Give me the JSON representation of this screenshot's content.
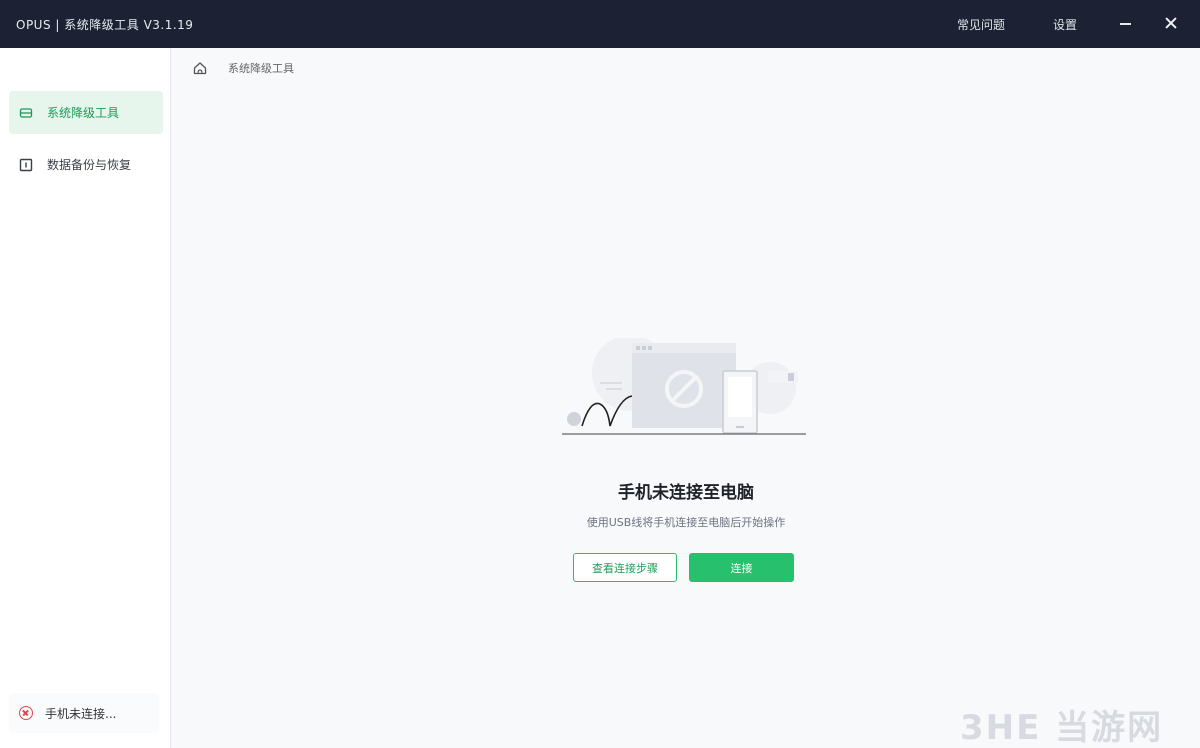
{
  "titlebar": {
    "app_title": "OPUS | 系统降级工具  V3.1.19",
    "faq": "常见问题",
    "settings": "设置"
  },
  "sidebar": {
    "items": [
      {
        "label": "系统降级工具",
        "active": true
      },
      {
        "label": "数据备份与恢复",
        "active": false
      }
    ],
    "status": "手机未连接..."
  },
  "main": {
    "breadcrumb": "系统降级工具",
    "empty_state": {
      "title": "手机未连接至电脑",
      "subtitle": "使用USB线将手机连接至电脑后开始操作",
      "view_steps_label": "查看连接步骤",
      "connect_label": "连接"
    }
  },
  "watermark": "3HE 当游网",
  "colors": {
    "titlebar_bg": "#1c2233",
    "accent_green": "#27c06c",
    "active_item_bg": "#e7f6ed",
    "error_red": "#e0474c"
  }
}
